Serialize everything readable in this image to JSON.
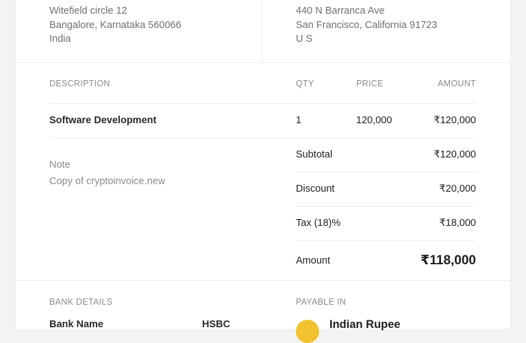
{
  "from": {
    "street": "Witefield circle 12",
    "city_line": "Bangalore, Karnataka 560066",
    "country": "India"
  },
  "to": {
    "street": "440 N Barranca Ave",
    "city_line": "San Francisco, California 91723",
    "country": "U S"
  },
  "table": {
    "headers": {
      "description": "DESCRIPTION",
      "qty": "QTY",
      "price": "PRICE",
      "amount": "AMOUNT"
    },
    "rows": [
      {
        "description": "Software Development",
        "qty": "1",
        "price": "120,000",
        "amount": "₹120,000"
      }
    ]
  },
  "note": {
    "label": "Note",
    "text": "Copy of cryptoinvoice.new"
  },
  "summary": {
    "subtotal_label": "Subtotal",
    "subtotal_value": "₹120,000",
    "discount_label": "Discount",
    "discount_value": "₹20,000",
    "tax_label": "Tax (18)%",
    "tax_value": "₹18,000",
    "amount_label": "Amount",
    "amount_value": "₹118,000"
  },
  "bank": {
    "heading": "BANK DETAILS",
    "name_label": "Bank Name",
    "name_value": "HSBC"
  },
  "payable": {
    "heading": "PAYABLE IN",
    "currency": "Indian Rupee",
    "coin_color": "#f2c230"
  }
}
